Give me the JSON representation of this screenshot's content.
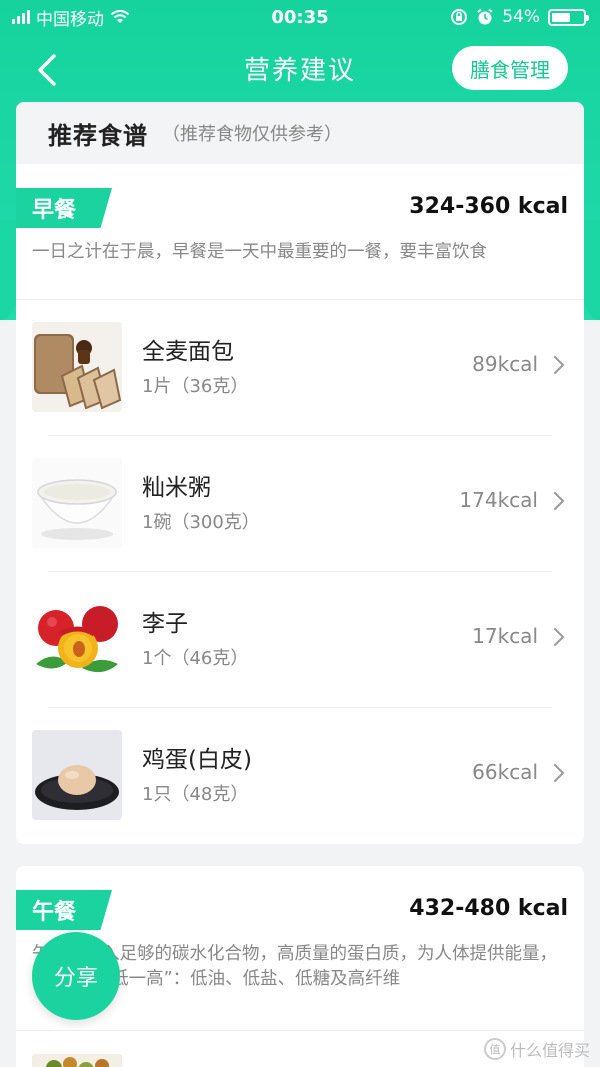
{
  "status_bar": {
    "carrier": "中国移动",
    "time": "00:35",
    "battery": "54%",
    "battery_level": 0.54
  },
  "nav": {
    "title": "营养建议",
    "diet_button": "膳食管理"
  },
  "recommend": {
    "title": "推荐食谱",
    "subtitle": "（推荐食物仅供参考）"
  },
  "breakfast": {
    "tag": "早餐",
    "kcal": "324-360 kcal",
    "desc": "一日之计在于晨，早餐是一天中最重要的一餐，要丰富饮食",
    "foods": [
      {
        "name": "全麦面包",
        "qty": "1片（36克）",
        "kcal": "89kcal",
        "icon": "bread-image"
      },
      {
        "name": "籼米粥",
        "qty": "1碗（300克）",
        "kcal": "174kcal",
        "icon": "porridge-image"
      },
      {
        "name": "李子",
        "qty": "1个（46克）",
        "kcal": "17kcal",
        "icon": "plum-image"
      },
      {
        "name": "鸡蛋(白皮)",
        "qty": "1只（48克）",
        "kcal": "66kcal",
        "icon": "egg-image"
      }
    ]
  },
  "lunch": {
    "tag": "午餐",
    "kcal": "432-480 kcal",
    "desc": "午餐要摄入足够的碳水化合物，高质量的蛋白质，为人体提供能量，要注意“三低一高”：低油、低盐、低糖及高纤维"
  },
  "share_button": "分享",
  "watermark": "什么值得买",
  "colors": {
    "accent": "#1bd39f",
    "gray_text": "#888888"
  }
}
